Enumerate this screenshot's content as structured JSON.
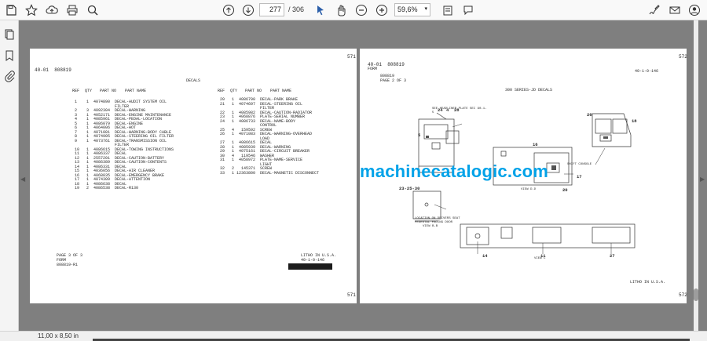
{
  "toolbar": {
    "page_current": "277",
    "page_total": "/ 306",
    "zoom": "59,6%",
    "icons": [
      "save-icon",
      "bookmark-star-icon",
      "upload-icon",
      "print-icon",
      "zoom-search-icon",
      "page-up-icon",
      "page-down-icon",
      "select-cursor-icon",
      "hand-pan-icon",
      "zoom-out-icon",
      "zoom-in-icon",
      "fit-page-icon",
      "comment-icon",
      "sign-icon",
      "mail-icon",
      "account-icon"
    ],
    "accent": "#2b5ea9"
  },
  "left_rail": {
    "icons": [
      "copy-pages-icon",
      "bookmark-icon",
      "attachment-icon"
    ]
  },
  "status": {
    "page_size": "11,00 x 8,50 in"
  },
  "watermark": "machinecatalogic.com",
  "left_page": {
    "page_number_top": "571",
    "page_number_bottom": "571",
    "section": "40-01  808819",
    "title": "DECALS",
    "header_ref": "REF",
    "header_qty": "QTY",
    "header_part": "PART NO",
    "header_name": "PART NAME",
    "left_list": [
      "1    1  4074890  DECAL-AUDIT SYSTEM OIL",
      "                 FILTER",
      "2    3  4092304  DECAL-WARNING",
      "3    1  4052171  DECAL-ENGINE MAINTENANCE",
      "4    1  4085961  DECAL-PEDAL-LOCATION",
      "5    1  4086079  DECAL-ENGINE",
      "6    1  4064006  DECAL-HOT",
      "7    1  4071081  DECAL-WARNING-BODY CABLE",
      "8    1  4074905  DECAL-STEERING OIL FILTER",
      "9    1  4073761  DECAL-TRANSMISSION OIL",
      "                 FILTER",
      "10   1  4086615  DECAL-TOWING INSTRUCTIONS",
      "11   1  4086337  DECAL",
      "12   1  2557201  DECAL-CAUTION-BATTERY",
      "13   1  4086389  DECAL-CAUTION-CONTENTS",
      "14   1  4086331  DECAL",
      "15   1  4036056  DECAL-AIR CLEANER",
      "16   1  4068835  DECAL-EMERGENCY BRAKE",
      "17   1  4074309  DECAL-ATTENTION",
      "18   1  4086638  DECAL",
      "19   2  4086538  DECAL-R130"
    ],
    "right_list": [
      "20   1  4086790  DECAL-PARK BRAKE",
      "21   1  4074697  DECAL-STEERING OIL",
      "                 FILTER",
      "22   1  4085982  DECAL-CAUTION-RADIATOR",
      "23   1  4068876  PLATE-SERIAL NUMBER",
      "24   1  4086733  DECAL-NAME-BODY",
      "                 CONTROL",
      "25   4   159592  SCREW",
      "26   1  4071083  DECAL-WARNING-OVERHEAD",
      "                 LOAD",
      "27   1  4086615  DECAL",
      "28   1  4085939  DECAL-WARNING",
      "29   1  4075161  DECAL-CIRCUIT BREAKER",
      "30   4   119546  WASHER",
      "31   1  4058972  PLATE-NAME-SERVICE",
      "                 LIGHT",
      "32   2   145371  SCREW",
      "33   1 12363800  DECAL-MAGNETIC DISCONNECT"
    ],
    "footer_page": "PAGE 3 OF 3",
    "footer_form": "FORM",
    "footer_code": "808819-R1",
    "litho": "LITHO IN U.S.A.",
    "litho_code": "40-1-0-146"
  },
  "right_page": {
    "page_number_top": "572",
    "page_number_bottom": "572",
    "section": "40-01  808819",
    "form": "FORM",
    "form_code": "808819",
    "page_of": "PAGE 2 OF 3",
    "title": "300 SERIES-JD DECALS",
    "code_right": "40-1-0-146",
    "litho": "LITHO IN U.S.A.",
    "callouts": [
      "24",
      "4",
      "28",
      "5",
      "26",
      "18",
      "16",
      "17",
      "20",
      "23-25-30",
      "14",
      "11",
      "27"
    ],
    "label_headliner": "SEE HEADLINER PLATE SEC 90-1-5",
    "label_console": "SHIFT CONSOLE",
    "label_view_dd": "VIEW D-D",
    "label_location": "LOCATION ON DRIVERS SEAT PEDESTAL FACING DOOR",
    "label_view_bb": "VIEW B-B",
    "label_view_c": "VIEW C"
  }
}
